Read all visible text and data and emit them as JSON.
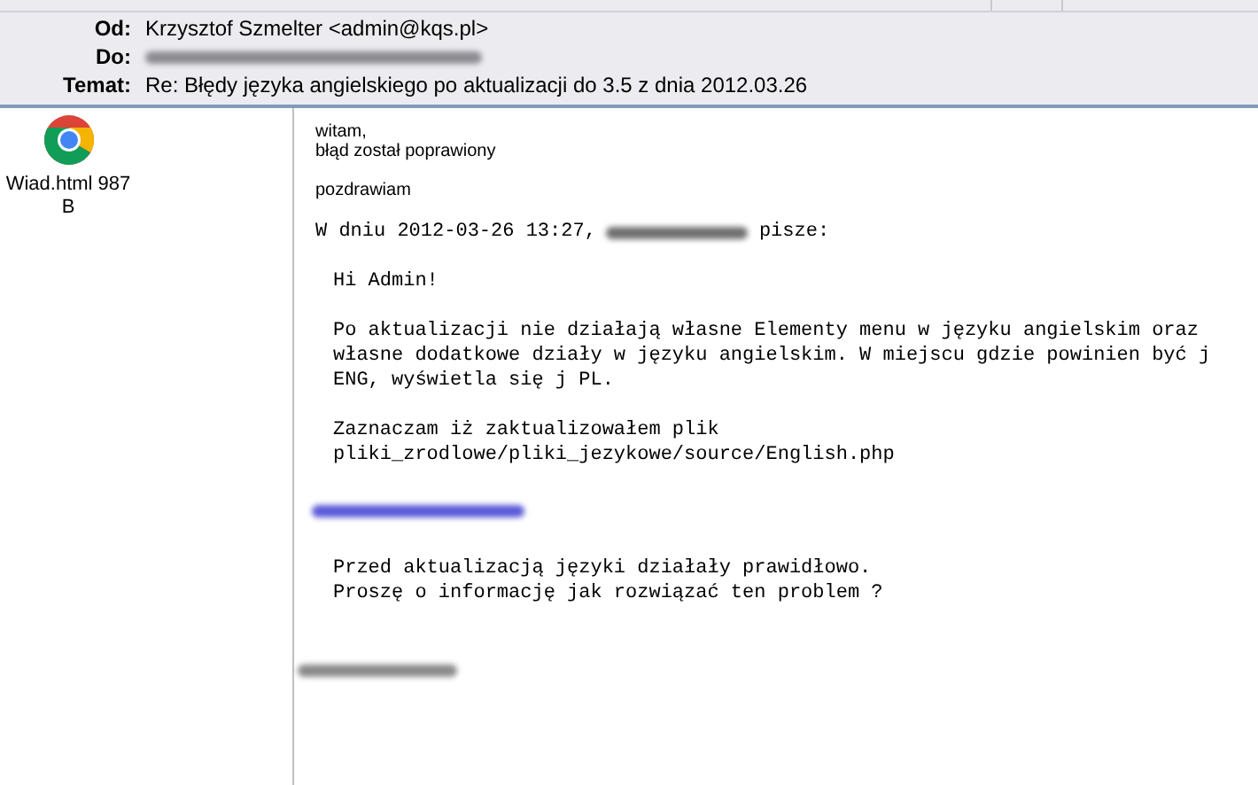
{
  "header": {
    "fields": [
      {
        "label": "Od:",
        "kind": "text",
        "value": "Krzysztof Szmelter <admin@kqs.pl>"
      },
      {
        "label": "Do:",
        "kind": "redacted"
      },
      {
        "label": "Temat:",
        "kind": "text",
        "value": "Re: Błędy języka angielskiego po aktualizacji do 3.5 z dnia 2012.03.26"
      }
    ]
  },
  "attachment": {
    "name": "Wiad.html 987 B"
  },
  "message": {
    "reply": [
      [
        "witam,",
        "błąd został poprawiony"
      ],
      [
        "pozdrawiam"
      ]
    ],
    "quote_intro": {
      "before": "W dniu 2012-03-26 13:27,",
      "after": "pisze:"
    },
    "quoted": [
      {
        "kind": "text",
        "lines": [
          "Hi Admin!"
        ]
      },
      {
        "kind": "text",
        "lines": [
          "Po aktualizacji nie działają własne Elementy menu w języku angielskim oraz",
          "własne dodatkowe działy w języku angielskim. W miejscu gdzie powinien być j",
          "ENG, wyświetla się j PL."
        ]
      },
      {
        "kind": "text",
        "lines": [
          "Zaznaczam iż zaktualizowałem plik",
          "pliki_zrodlowe/pliki_jezykowe/source/English.php"
        ]
      },
      {
        "kind": "redacted-link"
      },
      {
        "kind": "text",
        "lines": [
          "Przed aktualizacją języki działały prawidłowo.",
          "Proszę o informację jak rozwiązać ten problem ?"
        ]
      }
    ]
  }
}
